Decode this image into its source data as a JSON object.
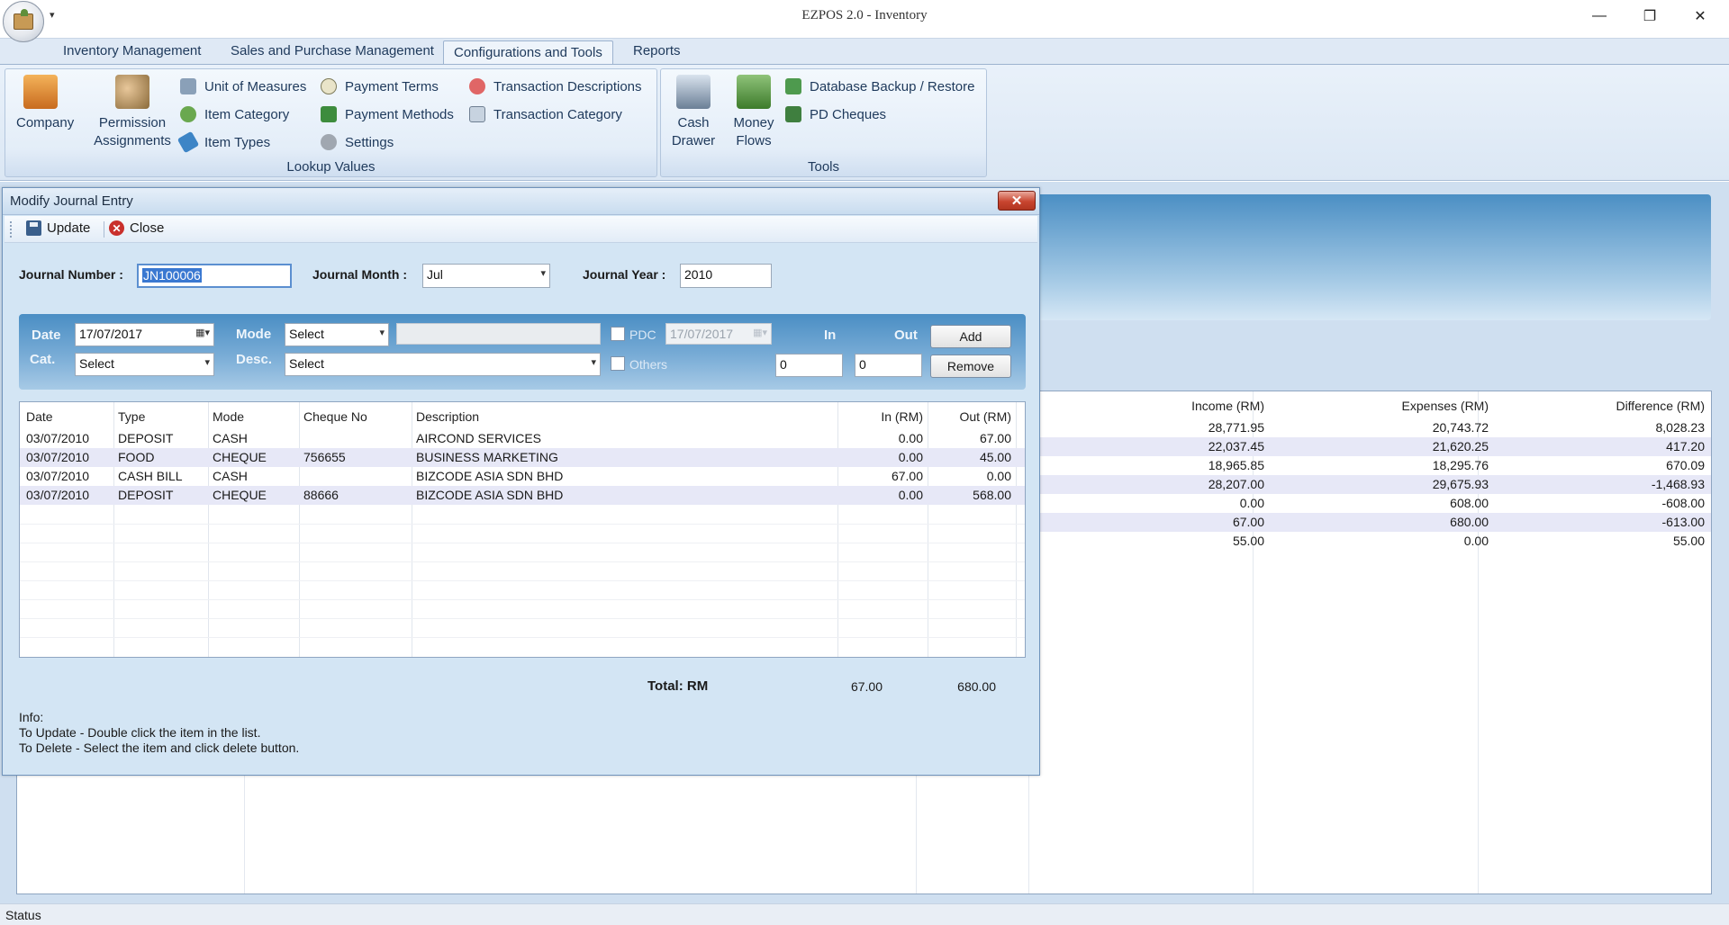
{
  "window": {
    "title": "EZPOS 2.0 - Inventory",
    "min_glyph": "—",
    "restore_glyph": "❐",
    "close_glyph": "✕"
  },
  "ribbon": {
    "tabs": [
      {
        "label": "Inventory Management"
      },
      {
        "label": "Sales and Purchase Management"
      },
      {
        "label": "Configurations and Tools"
      },
      {
        "label": "Reports"
      }
    ],
    "active_tab": "Configurations and Tools",
    "groups": {
      "lookup": {
        "label": "Lookup Values",
        "company": "Company",
        "permission_1": "Permission",
        "permission_2": "Assignments",
        "unit_of_measures": "Unit of Measures",
        "item_category": "Item Category",
        "item_types": "Item Types",
        "payment_terms": "Payment Terms",
        "payment_methods": "Payment Methods",
        "settings": "Settings",
        "transaction_descriptions": "Transaction Descriptions",
        "transaction_category": "Transaction Category"
      },
      "tools": {
        "label": "Tools",
        "cash_1": "Cash",
        "cash_2": "Drawer",
        "money_1": "Money",
        "money_2": "Flows",
        "db_backup": "Database Backup / Restore",
        "pd_cheques": "PD Cheques"
      }
    }
  },
  "background_table": {
    "headers": [
      "Income (RM)",
      "Expenses (RM)",
      "Difference (RM)"
    ],
    "rows": [
      [
        "28,771.95",
        "20,743.72",
        "8,028.23"
      ],
      [
        "22,037.45",
        "21,620.25",
        "417.20"
      ],
      [
        "18,965.85",
        "18,295.76",
        "670.09"
      ],
      [
        "28,207.00",
        "29,675.93",
        "-1,468.93"
      ],
      [
        "0.00",
        "608.00",
        "-608.00"
      ],
      [
        "67.00",
        "680.00",
        "-613.00"
      ],
      [
        "55.00",
        "0.00",
        "55.00"
      ]
    ]
  },
  "status": {
    "text": "Status"
  },
  "dialog": {
    "title": "Modify Journal Entry",
    "close_glyph": "✕",
    "toolbar": {
      "update": "Update",
      "close": "Close"
    },
    "journal_number": {
      "label": "Journal Number :",
      "value": "JN100006"
    },
    "journal_month": {
      "label": "Journal Month :",
      "value": "Jul"
    },
    "journal_year": {
      "label": "Journal Year :",
      "value": "2010"
    },
    "entry": {
      "date_label": "Date",
      "date_value": "17/07/2017",
      "mode_label": "Mode",
      "mode_value": "Select",
      "pdc_label": "PDC",
      "pdc_date": "17/07/2017",
      "in_label": "In",
      "out_label": "Out",
      "add": "Add",
      "cat_label": "Cat.",
      "cat_value": "Select",
      "desc_label": "Desc.",
      "desc_value": "Select",
      "others_label": "Others",
      "in_value": "0",
      "out_value": "0",
      "remove": "Remove"
    },
    "grid": {
      "headers": [
        "Date",
        "Type",
        "Mode",
        "Cheque No",
        "Description",
        "In (RM)",
        "Out (RM)"
      ],
      "rows": [
        [
          "03/07/2010",
          "DEPOSIT",
          "CASH",
          "",
          "AIRCOND SERVICES",
          "0.00",
          "67.00"
        ],
        [
          "03/07/2010",
          "FOOD",
          "CHEQUE",
          "756655",
          "BUSINESS MARKETING",
          "0.00",
          "45.00"
        ],
        [
          "03/07/2010",
          "CASH BILL",
          "CASH",
          "",
          "BIZCODE ASIA SDN BHD",
          "67.00",
          "0.00"
        ],
        [
          "03/07/2010",
          "DEPOSIT",
          "CHEQUE",
          "88666",
          "BIZCODE ASIA SDN BHD",
          "0.00",
          "568.00"
        ]
      ]
    },
    "total": {
      "label": "Total: RM",
      "in": "67.00",
      "out": "680.00"
    },
    "info": {
      "title": "Info:",
      "line1": "To Update - Double click the item in the list.",
      "line2": "To Delete - Select the item and click delete button."
    }
  },
  "colors": {
    "ribbon_bg": "#dbe7f4",
    "dialog_bg": "#d3e5f4",
    "entry_panel": "#4a8ec4",
    "alt_row": "#e7e8f7",
    "close_red": "#c8452f"
  }
}
